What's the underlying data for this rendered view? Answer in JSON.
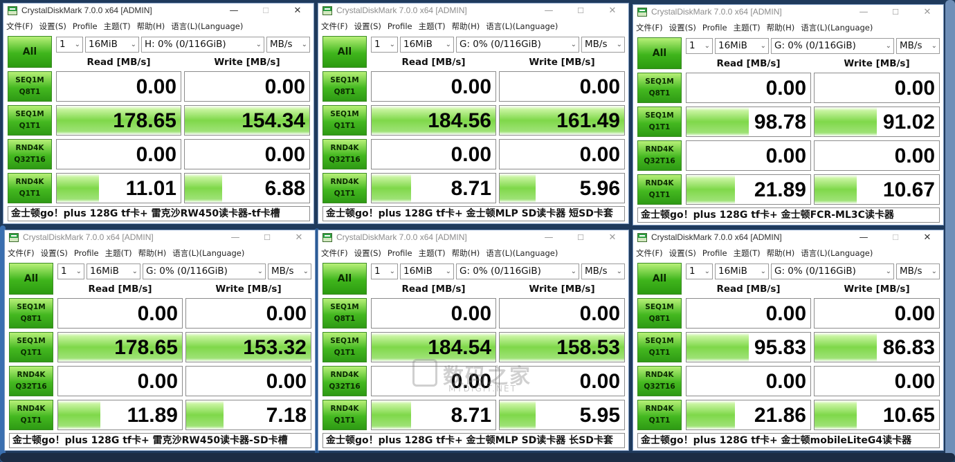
{
  "app": {
    "title": "CrystalDiskMark 7.0.0 x64 [ADMIN]",
    "all_button": "All",
    "read_header": "Read [MB/s]",
    "write_header": "Write [MB/s]",
    "menu": [
      "文件(F)",
      "设置(S)",
      "Profile",
      "主题(T)",
      "帮助(H)",
      "语言(L)(Language)"
    ],
    "row_labels": [
      {
        "line1": "SEQ1M",
        "line2": "Q8T1"
      },
      {
        "line1": "SEQ1M",
        "line2": "Q1T1"
      },
      {
        "line1": "RND4K",
        "line2": "Q32T16"
      },
      {
        "line1": "RND4K",
        "line2": "Q1T1"
      }
    ],
    "controls": {
      "minimize": "—",
      "maximize": "☐",
      "close": "✕"
    }
  },
  "theme": {
    "accent_green": "#44b820",
    "bar_green": "#7fd84a"
  },
  "watermark": {
    "text": "数码之家",
    "sub": "MYDIGIT.NET"
  },
  "windows": [
    {
      "count": "1",
      "size": "16MiB",
      "drive": "H: 0% (0/116GiB)",
      "unit": "MB/s",
      "rows": [
        {
          "read": "0.00",
          "write": "0.00",
          "read_frac": 0,
          "write_frac": 0
        },
        {
          "read": "178.65",
          "write": "154.34",
          "read_frac": 1.0,
          "write_frac": 1.0
        },
        {
          "read": "0.00",
          "write": "0.00",
          "read_frac": 0,
          "write_frac": 0
        },
        {
          "read": "11.01",
          "write": "6.88",
          "read_frac": 0.34,
          "write_frac": 0.3
        }
      ],
      "comment": "金士顿go！plus 128G tf卡+ 雷克沙RW450读卡器-tf卡槽"
    },
    {
      "count": "1",
      "size": "16MiB",
      "drive": "G: 0% (0/116GiB)",
      "unit": "MB/s",
      "rows": [
        {
          "read": "0.00",
          "write": "0.00",
          "read_frac": 0,
          "write_frac": 0
        },
        {
          "read": "184.56",
          "write": "161.49",
          "read_frac": 1.0,
          "write_frac": 1.0
        },
        {
          "read": "0.00",
          "write": "0.00",
          "read_frac": 0,
          "write_frac": 0
        },
        {
          "read": "8.71",
          "write": "5.96",
          "read_frac": 0.32,
          "write_frac": 0.29
        }
      ],
      "comment": "金士顿go！plus 128G tf卡+ 金士顿MLP SD读卡器 短SD卡套"
    },
    {
      "count": "1",
      "size": "16MiB",
      "drive": "G: 0% (0/116GiB)",
      "unit": "MB/s",
      "rows": [
        {
          "read": "0.00",
          "write": "0.00",
          "read_frac": 0,
          "write_frac": 0
        },
        {
          "read": "98.78",
          "write": "91.02",
          "read_frac": 0.5,
          "write_frac": 0.5
        },
        {
          "read": "0.00",
          "write": "0.00",
          "read_frac": 0,
          "write_frac": 0
        },
        {
          "read": "21.89",
          "write": "10.67",
          "read_frac": 0.39,
          "write_frac": 0.34
        }
      ],
      "comment": "金士顿go！plus 128G tf卡+ 金士顿FCR-ML3C读卡器"
    },
    {
      "count": "1",
      "size": "16MiB",
      "drive": "G: 0% (0/116GiB)",
      "unit": "MB/s",
      "rows": [
        {
          "read": "0.00",
          "write": "0.00",
          "read_frac": 0,
          "write_frac": 0
        },
        {
          "read": "178.65",
          "write": "153.32",
          "read_frac": 1.0,
          "write_frac": 1.0
        },
        {
          "read": "0.00",
          "write": "0.00",
          "read_frac": 0,
          "write_frac": 0
        },
        {
          "read": "11.89",
          "write": "7.18",
          "read_frac": 0.34,
          "write_frac": 0.3
        }
      ],
      "comment": "金士顿go！plus 128G tf卡+ 雷克沙RW450读卡器-SD卡槽"
    },
    {
      "count": "1",
      "size": "16MiB",
      "drive": "G: 0% (0/116GiB)",
      "unit": "MB/s",
      "rows": [
        {
          "read": "0.00",
          "write": "0.00",
          "read_frac": 0,
          "write_frac": 0
        },
        {
          "read": "184.54",
          "write": "158.53",
          "read_frac": 1.0,
          "write_frac": 1.0
        },
        {
          "read": "0.00",
          "write": "0.00",
          "read_frac": 0,
          "write_frac": 0
        },
        {
          "read": "8.71",
          "write": "5.95",
          "read_frac": 0.32,
          "write_frac": 0.29
        }
      ],
      "comment": "金士顿go！plus 128G tf卡+ 金士顿MLP SD读卡器 长SD卡套"
    },
    {
      "count": "1",
      "size": "16MiB",
      "drive": "G: 0% (0/116GiB)",
      "unit": "MB/s",
      "rows": [
        {
          "read": "0.00",
          "write": "0.00",
          "read_frac": 0,
          "write_frac": 0
        },
        {
          "read": "95.83",
          "write": "86.83",
          "read_frac": 0.5,
          "write_frac": 0.5
        },
        {
          "read": "0.00",
          "write": "0.00",
          "read_frac": 0,
          "write_frac": 0
        },
        {
          "read": "21.86",
          "write": "10.65",
          "read_frac": 0.39,
          "write_frac": 0.34
        }
      ],
      "comment": "金士顿go！plus 128G tf卡+ 金士顿mobileLiteG4读卡器"
    }
  ]
}
